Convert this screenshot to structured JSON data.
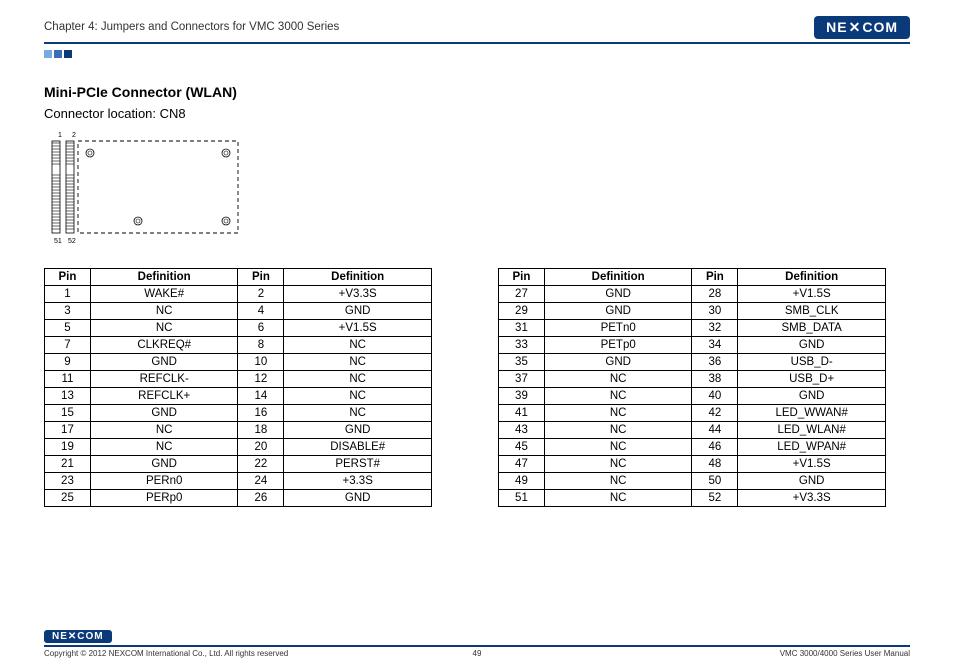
{
  "header": {
    "chapter": "Chapter 4: Jumpers and Connectors for VMC 3000 Series",
    "logo_text": "NEXCOM"
  },
  "section": {
    "title": "Mini-PCIe Connector (WLAN)",
    "subtitle": "Connector location: CN8"
  },
  "diagram": {
    "labels": {
      "tl": "1",
      "tr": "2",
      "bl": "51",
      "br": "52"
    }
  },
  "headers": {
    "pin": "Pin",
    "def": "Definition"
  },
  "table_left": [
    {
      "p1": "1",
      "d1": "WAKE#",
      "p2": "2",
      "d2": "+V3.3S"
    },
    {
      "p1": "3",
      "d1": "NC",
      "p2": "4",
      "d2": "GND"
    },
    {
      "p1": "5",
      "d1": "NC",
      "p2": "6",
      "d2": "+V1.5S"
    },
    {
      "p1": "7",
      "d1": "CLKREQ#",
      "p2": "8",
      "d2": "NC"
    },
    {
      "p1": "9",
      "d1": "GND",
      "p2": "10",
      "d2": "NC"
    },
    {
      "p1": "11",
      "d1": "REFCLK-",
      "p2": "12",
      "d2": "NC"
    },
    {
      "p1": "13",
      "d1": "REFCLK+",
      "p2": "14",
      "d2": "NC"
    },
    {
      "p1": "15",
      "d1": "GND",
      "p2": "16",
      "d2": "NC"
    },
    {
      "p1": "17",
      "d1": "NC",
      "p2": "18",
      "d2": "GND"
    },
    {
      "p1": "19",
      "d1": "NC",
      "p2": "20",
      "d2": "DISABLE#"
    },
    {
      "p1": "21",
      "d1": "GND",
      "p2": "22",
      "d2": "PERST#"
    },
    {
      "p1": "23",
      "d1": "PERn0",
      "p2": "24",
      "d2": "+3.3S"
    },
    {
      "p1": "25",
      "d1": "PERp0",
      "p2": "26",
      "d2": "GND"
    }
  ],
  "table_right": [
    {
      "p1": "27",
      "d1": "GND",
      "p2": "28",
      "d2": "+V1.5S"
    },
    {
      "p1": "29",
      "d1": "GND",
      "p2": "30",
      "d2": "SMB_CLK"
    },
    {
      "p1": "31",
      "d1": "PETn0",
      "p2": "32",
      "d2": "SMB_DATA"
    },
    {
      "p1": "33",
      "d1": "PETp0",
      "p2": "34",
      "d2": "GND"
    },
    {
      "p1": "35",
      "d1": "GND",
      "p2": "36",
      "d2": "USB_D-"
    },
    {
      "p1": "37",
      "d1": "NC",
      "p2": "38",
      "d2": "USB_D+"
    },
    {
      "p1": "39",
      "d1": "NC",
      "p2": "40",
      "d2": "GND"
    },
    {
      "p1": "41",
      "d1": "NC",
      "p2": "42",
      "d2": "LED_WWAN#"
    },
    {
      "p1": "43",
      "d1": "NC",
      "p2": "44",
      "d2": "LED_WLAN#"
    },
    {
      "p1": "45",
      "d1": "NC",
      "p2": "46",
      "d2": "LED_WPAN#"
    },
    {
      "p1": "47",
      "d1": "NC",
      "p2": "48",
      "d2": "+V1.5S"
    },
    {
      "p1": "49",
      "d1": "NC",
      "p2": "50",
      "d2": "GND"
    },
    {
      "p1": "51",
      "d1": "NC",
      "p2": "52",
      "d2": "+V3.3S"
    }
  ],
  "footer": {
    "logo_text": "NEXCOM",
    "copyright": "Copyright © 2012 NEXCOM International Co., Ltd. All rights reserved",
    "page": "49",
    "manual": "VMC 3000/4000 Series User Manual"
  }
}
